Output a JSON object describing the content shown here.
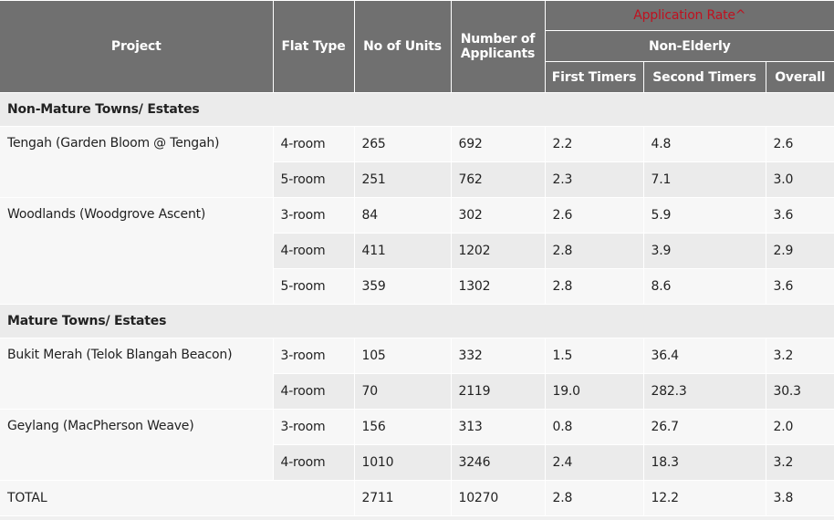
{
  "header": {
    "project": "Project",
    "flat_type": "Flat Type",
    "no_of_units": "No of Units",
    "number_of_applicants_line1": "Number of",
    "number_of_applicants_line2": "Applicants",
    "application_rate": "Application Rate^",
    "non_elderly": "Non-Elderly",
    "first_timers": "First Timers",
    "second_timers": "Second Timers",
    "overall": "Overall"
  },
  "colors": {
    "header_bg": "#707070",
    "application_rate_text": "#c0111f",
    "row_light": "#f7f7f7",
    "row_shaded": "#ebebeb"
  },
  "sections": [
    {
      "title": "Non-Mature Towns/ Estates",
      "projects": [
        {
          "name": "Tengah (Garden Bloom @ Tengah)",
          "rows": [
            {
              "flat_type": "4-room",
              "units": "265",
              "applicants": "692",
              "first_timers": "2.2",
              "second_timers": "4.8",
              "overall": "2.6"
            },
            {
              "flat_type": "5-room",
              "units": "251",
              "applicants": "762",
              "first_timers": "2.3",
              "second_timers": "7.1",
              "overall": "3.0"
            }
          ]
        },
        {
          "name": "Woodlands (Woodgrove Ascent)",
          "rows": [
            {
              "flat_type": "3-room",
              "units": "84",
              "applicants": "302",
              "first_timers": "2.6",
              "second_timers": "5.9",
              "overall": "3.6"
            },
            {
              "flat_type": "4-room",
              "units": "411",
              "applicants": "1202",
              "first_timers": "2.8",
              "second_timers": "3.9",
              "overall": "2.9"
            },
            {
              "flat_type": "5-room",
              "units": "359",
              "applicants": "1302",
              "first_timers": "2.8",
              "second_timers": "8.6",
              "overall": "3.6"
            }
          ]
        }
      ]
    },
    {
      "title": "Mature Towns/ Estates",
      "projects": [
        {
          "name": "Bukit Merah (Telok Blangah Beacon)",
          "rows": [
            {
              "flat_type": "3-room",
              "units": "105",
              "applicants": "332",
              "first_timers": "1.5",
              "second_timers": "36.4",
              "overall": "3.2"
            },
            {
              "flat_type": "4-room",
              "units": "70",
              "applicants": "2119",
              "first_timers": "19.0",
              "second_timers": "282.3",
              "overall": "30.3"
            }
          ]
        },
        {
          "name": "Geylang (MacPherson Weave)",
          "rows": [
            {
              "flat_type": "3-room",
              "units": "156",
              "applicants": "313",
              "first_timers": "0.8",
              "second_timers": "26.7",
              "overall": "2.0"
            },
            {
              "flat_type": "4-room",
              "units": "1010",
              "applicants": "3246",
              "first_timers": "2.4",
              "second_timers": "18.3",
              "overall": "3.2"
            }
          ]
        }
      ]
    }
  ],
  "total": {
    "label": "TOTAL",
    "units": "2711",
    "applicants": "10270",
    "first_timers": "2.8",
    "second_timers": "12.2",
    "overall": "3.8"
  }
}
